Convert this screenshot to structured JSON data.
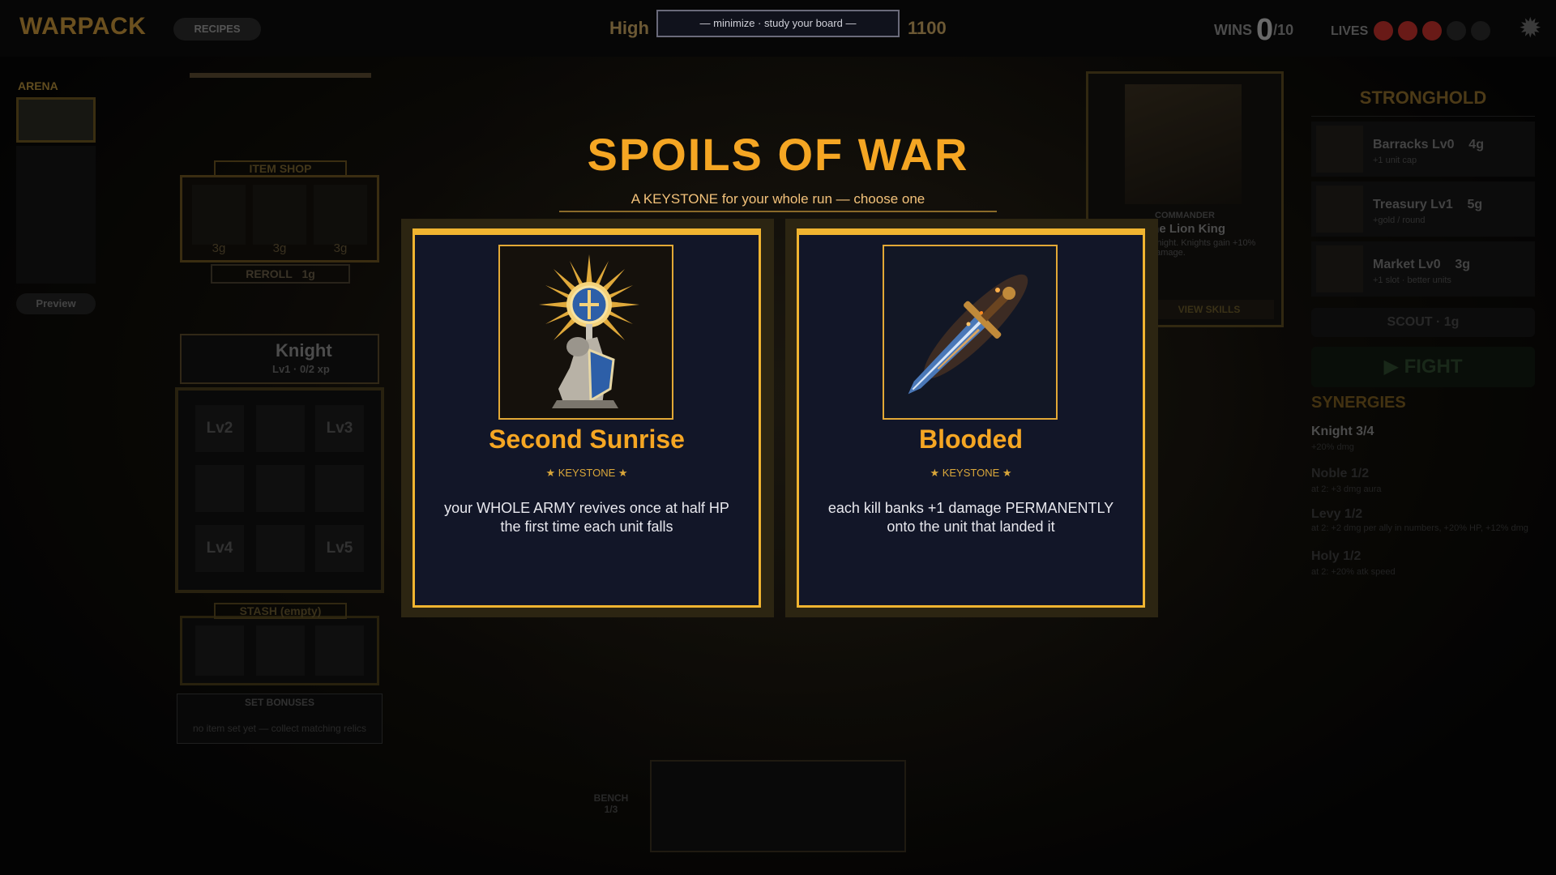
{
  "header": {
    "title": "WARPACK",
    "recipes_label": "RECIPES",
    "highscore_left": "High",
    "highscore_right": "1100",
    "wins_label": "WINS",
    "wins_value": "0",
    "wins_total": "/10",
    "lives_label": "LIVES",
    "lives": [
      "#c0302a",
      "#c0302a",
      "#c0302a",
      "#2a2a2a",
      "#2a2a2a"
    ],
    "gear_icon": "gear-icon"
  },
  "left": {
    "arena_label": "ARENA",
    "preview_label": "Preview",
    "item_shop_label": "ITEM SHOP",
    "shop_prices": [
      "3g",
      "3g",
      "3g"
    ],
    "reroll_label": "REROLL",
    "reroll_cost": "1g",
    "unit_name": "Knight",
    "unit_level": "Lv1 · 0/2 xp",
    "level_slots": [
      "Lv2",
      "",
      "Lv3",
      "",
      "",
      "",
      "Lv4",
      "",
      "Lv5"
    ],
    "stash_label": "STASH (empty)",
    "set_bonuses_label": "SET BONUSES",
    "set_bonuses_text": "no item set yet — collect matching relics"
  },
  "right": {
    "commander_label": "COMMANDER",
    "commander_name": "The Lion King",
    "commander_desc": "Knight. Knights gain +10% damage.",
    "view_skills_label": "VIEW SKILLS",
    "stronghold_title": "STRONGHOLD",
    "buildings": [
      {
        "name": "Barracks  Lv0",
        "cost": "4g",
        "sub": "+1 unit cap"
      },
      {
        "name": "Treasury  Lv1",
        "cost": "5g",
        "sub": "+gold / round"
      },
      {
        "name": "Market  Lv0",
        "cost": "3g",
        "sub": "+1 slot · better units"
      }
    ],
    "scout_label": "SCOUT · 1g",
    "fight_label": "FIGHT",
    "synergies_title": "SYNERGIES",
    "synergies": [
      {
        "name": "Knight  3/4",
        "sub": "+20% dmg",
        "color": "#8a8a8a"
      },
      {
        "name": "Noble  1/2",
        "sub": "at 2: +3 dmg aura",
        "color": "#3e3e3e"
      },
      {
        "name": "Levy  1/2",
        "sub": "at 2: +2 dmg per ally in numbers, +20% HP, +12% dmg",
        "color": "#3e3e3e"
      },
      {
        "name": "Holy  1/2",
        "sub": "at 2: +20% atk speed",
        "color": "#3e3e3e"
      }
    ]
  },
  "board": {
    "bench_label": "BENCH",
    "bench_count": "1/3"
  },
  "overlay": {
    "minimize_label": "—   minimize · study your board   —",
    "title": "SPOILS OF WAR",
    "subtitle": "A KEYSTONE for your whole run — choose one",
    "cards": [
      {
        "name": "Second Sunrise",
        "tag": "★ KEYSTONE ★",
        "description": "your WHOLE ARMY revives once at half HP the first time each unit falls",
        "icon": "kneeling-knight-sun-icon"
      },
      {
        "name": "Blooded",
        "tag": "★ KEYSTONE ★",
        "description": "each kill banks +1 damage PERMANENTLY onto the unit that landed it",
        "icon": "flaming-sword-icon"
      }
    ]
  }
}
